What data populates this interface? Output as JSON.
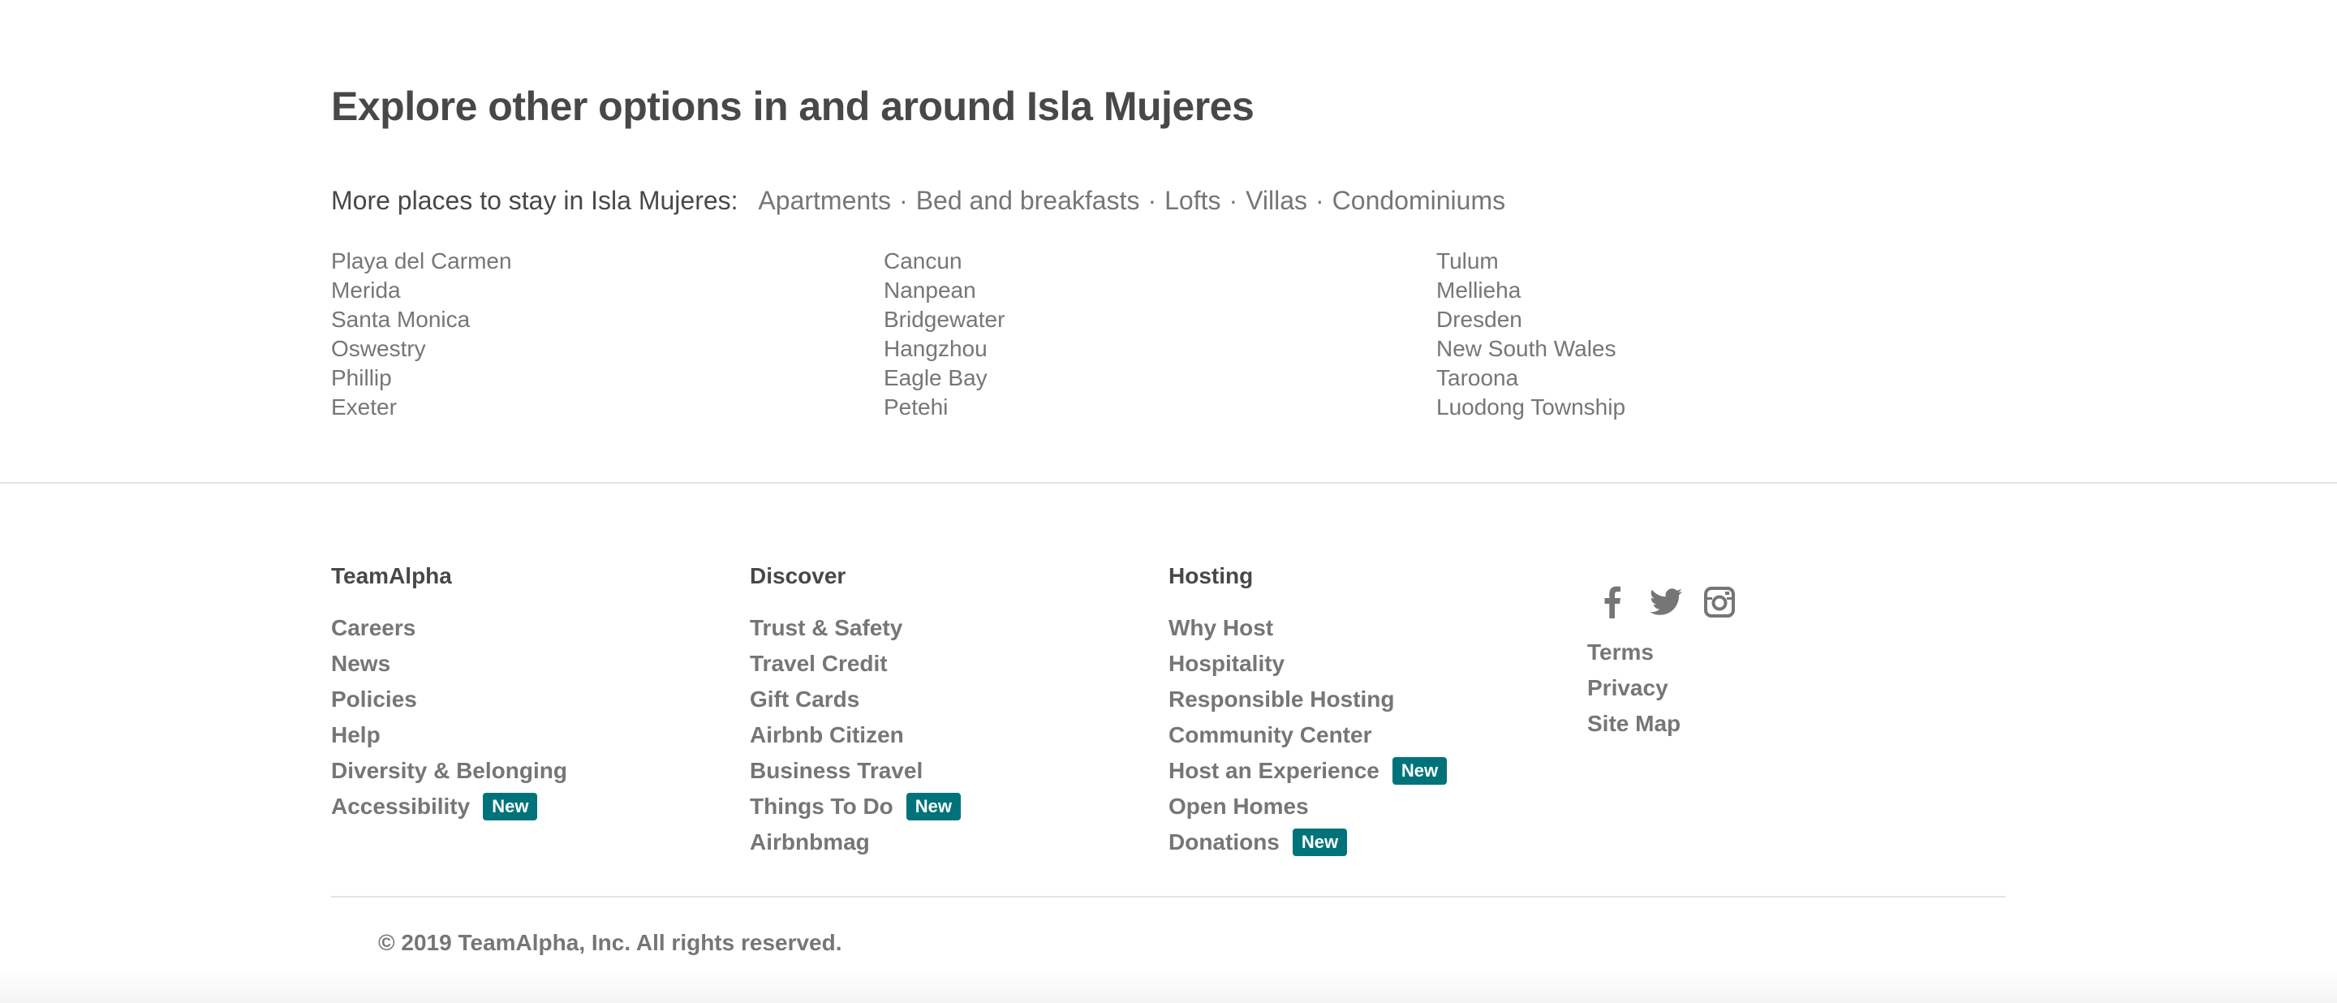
{
  "explore": {
    "title": "Explore other options in and around Isla Mujeres",
    "more_places_label": "More places to stay in Isla Mujeres:",
    "place_types": [
      "Apartments",
      "Bed and breakfasts",
      "Lofts",
      "Villas",
      "Condominiums"
    ],
    "separator": "·",
    "city_columns": [
      [
        "Playa del Carmen",
        "Merida",
        "Santa Monica",
        "Oswestry",
        "Phillip",
        "Exeter"
      ],
      [
        "Cancun",
        "Nanpean",
        "Bridgewater",
        "Hangzhou",
        "Eagle Bay",
        "Petehi"
      ],
      [
        "Tulum",
        "Mellieha",
        "Dresden",
        "New South Wales",
        "Taroona",
        "Luodong Township"
      ]
    ]
  },
  "footer": {
    "columns": [
      {
        "heading": "TeamAlpha",
        "links": [
          {
            "label": "Careers",
            "badge": ""
          },
          {
            "label": "News",
            "badge": ""
          },
          {
            "label": "Policies",
            "badge": ""
          },
          {
            "label": "Help",
            "badge": ""
          },
          {
            "label": "Diversity & Belonging",
            "badge": ""
          },
          {
            "label": "Accessibility",
            "badge": "New"
          }
        ]
      },
      {
        "heading": "Discover",
        "links": [
          {
            "label": "Trust & Safety",
            "badge": ""
          },
          {
            "label": "Travel Credit",
            "badge": ""
          },
          {
            "label": "Gift Cards",
            "badge": ""
          },
          {
            "label": "Airbnb Citizen",
            "badge": ""
          },
          {
            "label": "Business Travel",
            "badge": ""
          },
          {
            "label": "Things To Do",
            "badge": "New"
          },
          {
            "label": "Airbnbmag",
            "badge": ""
          }
        ]
      },
      {
        "heading": "Hosting",
        "links": [
          {
            "label": "Why Host",
            "badge": ""
          },
          {
            "label": "Hospitality",
            "badge": ""
          },
          {
            "label": "Responsible Hosting",
            "badge": ""
          },
          {
            "label": "Community Center",
            "badge": ""
          },
          {
            "label": "Host an Experience",
            "badge": "New"
          },
          {
            "label": "Open Homes",
            "badge": ""
          },
          {
            "label": "Donations",
            "badge": "New"
          }
        ]
      }
    ],
    "social_icons": [
      "facebook-icon",
      "twitter-icon",
      "instagram-icon"
    ],
    "legal_links": [
      "Terms",
      "Privacy",
      "Site Map"
    ],
    "copyright": "© 2019 TeamAlpha, Inc. All rights reserved.",
    "colors": {
      "badge": "#00737a",
      "text": "#484848",
      "muted": "#767676"
    }
  }
}
